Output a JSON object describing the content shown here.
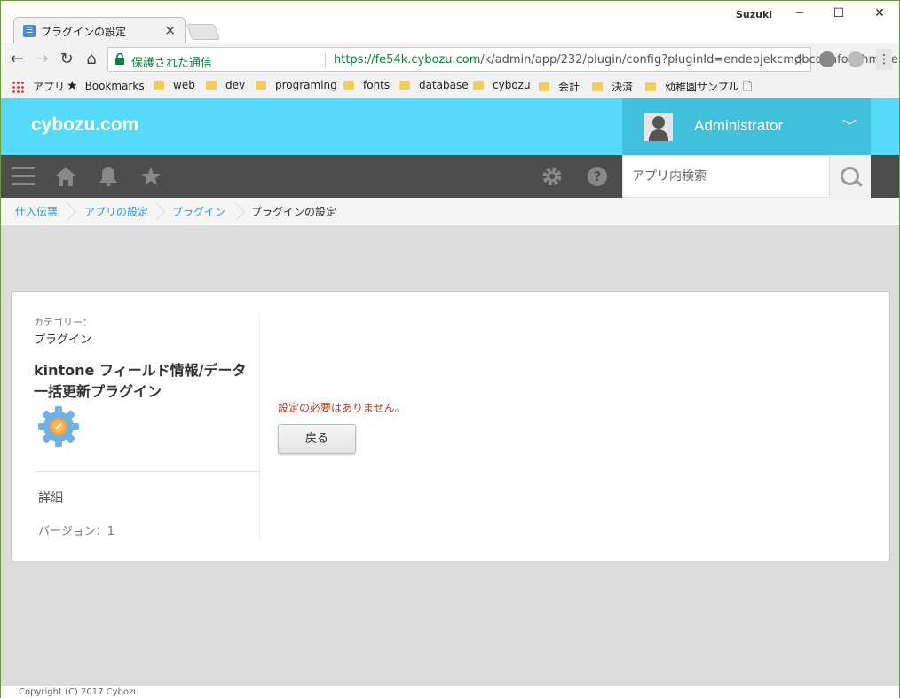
{
  "browser": {
    "tab_title": "プラグインの設定",
    "tab_favicon": "☰",
    "user": "Suzuki",
    "minimize": "─",
    "maximize": "☐",
    "close": "✕",
    "secure_label": "保護された通信",
    "url_host": "https://fe54k.cybozu.com",
    "url_path": "/k/admin/app/232/plugin/config?pluginId=endepjekcmdbcdanfokchmme...",
    "bookmarks": [
      "アプリ",
      "Bookmarks",
      "web",
      "dev",
      "programing",
      "fonts",
      "database",
      "cybozu",
      "会計",
      "決済",
      "幼稚園サンプル"
    ]
  },
  "header": {
    "logo": "cybozu.com",
    "username": "Administrator",
    "search_placeholder": "アプリ内検索"
  },
  "breadcrumb": [
    "仕入伝票",
    "アプリの設定",
    "プラグイン",
    "プラグインの設定"
  ],
  "plugin": {
    "category_label": "カテゴリー：",
    "category_value": "プラグイン",
    "name": "kintone フィールド情報/データ一括更新プラグイン",
    "details_label": "詳細",
    "version_label": "バージョン：",
    "version_value": "1"
  },
  "main": {
    "message": "設定の必要はありません。",
    "back_button": "戻る"
  },
  "footer": {
    "copyright": "Copyright (C) 2017 Cybozu"
  },
  "colors": {
    "header_accent": "#55dbf7",
    "user_panel": "#40c0da",
    "nav_bar": "#4d4d4d",
    "error_text": "#c0392b"
  }
}
